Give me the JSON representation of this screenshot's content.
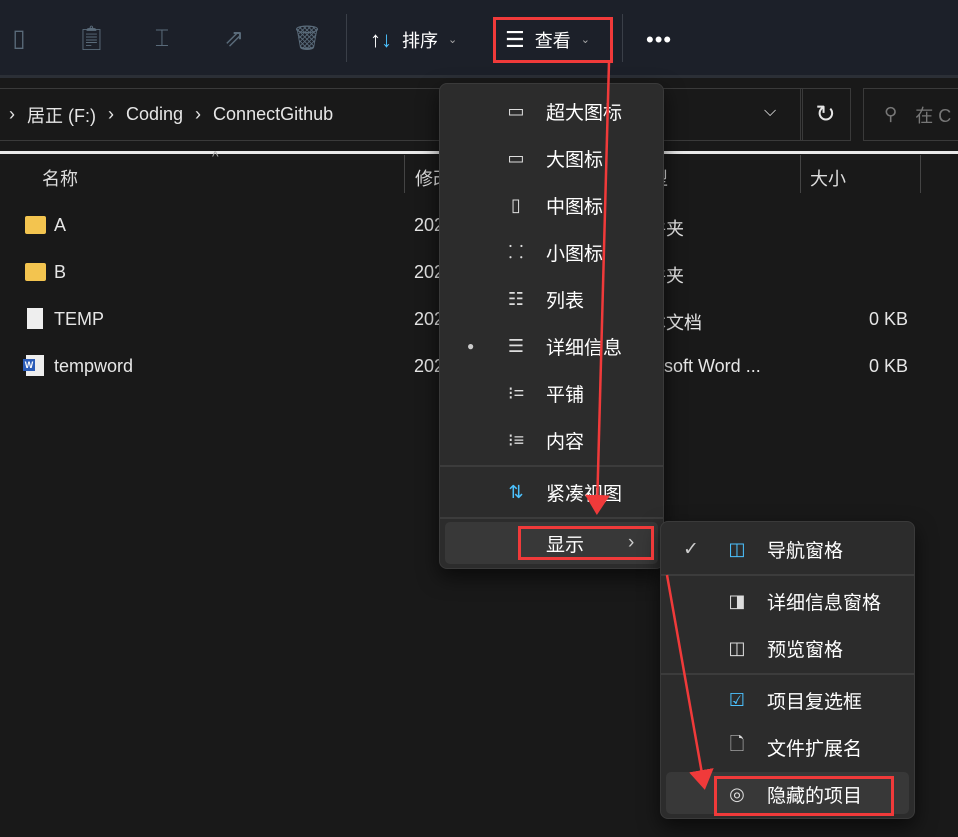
{
  "toolbar": {
    "sort_label": "排序",
    "view_label": "查看",
    "more_icon": "more-icon"
  },
  "address": {
    "path": [
      "居正 (F:)",
      "Coding",
      "ConnectGithub"
    ],
    "search_placeholder": "在 C"
  },
  "columns": {
    "name": "名称",
    "modified": "修改",
    "type": "类型",
    "size": "大小"
  },
  "files": [
    {
      "name": "A",
      "icon": "folder",
      "modified": "2023",
      "type": "文件夹",
      "size": ""
    },
    {
      "name": "B",
      "icon": "folder",
      "modified": "2023",
      "type": "文件夹",
      "size": ""
    },
    {
      "name": "TEMP",
      "icon": "text-file",
      "modified": "2023",
      "type": "文本文档",
      "size": "0 KB"
    },
    {
      "name": "tempword",
      "icon": "word-file",
      "modified": "2023",
      "type": "Microsoft Word ...",
      "size": "0 KB"
    }
  ],
  "view_menu": {
    "items": [
      "超大图标",
      "大图标",
      "中图标",
      "小图标",
      "列表",
      "详细信息",
      "平铺",
      "内容"
    ],
    "selected": "详细信息",
    "compact": "紧凑视图",
    "show": "显示"
  },
  "show_menu": {
    "items": [
      {
        "label": "导航窗格",
        "checked": true
      },
      {
        "label": "详细信息窗格",
        "checked": false
      },
      {
        "label": "预览窗格",
        "checked": false
      },
      {
        "label": "项目复选框",
        "checked": false
      },
      {
        "label": "文件扩展名",
        "checked": false
      },
      {
        "label": "隐藏的项目",
        "checked": false
      }
    ]
  },
  "colors": {
    "annotation": "#f03a3a",
    "accent": "#4cc2ff",
    "menu_bg": "#2c2c2c"
  }
}
